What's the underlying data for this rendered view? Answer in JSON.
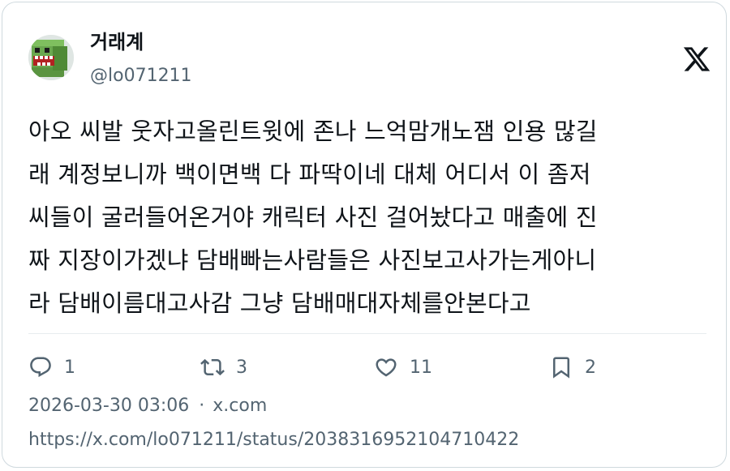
{
  "author": {
    "display_name": "거래계",
    "handle": "@lo071211",
    "avatar_icon": "green-block-creature-avatar"
  },
  "platform_icon": "x-logo-icon",
  "tweet": {
    "lines": [
      "아오 씨발 웃자고올린트윗에 존나 느억맘개노잼 인용 많길",
      "래 계정보니까 백이면백 다 파딱이네 대체 어디서 이 좀저",
      "씨들이 굴러들어온거야 캐릭터 사진 걸어놨다고 매출에 진",
      "짜 지장이가겠냐 담배빠는사람들은 사진보고사가는게아니",
      "라 담배이름대고사감 그냥 담배매대자체를안본다고"
    ]
  },
  "actions": {
    "reply": {
      "icon": "reply-icon",
      "count": "1"
    },
    "retweet": {
      "icon": "retweet-icon",
      "count": "3"
    },
    "like": {
      "icon": "heart-icon",
      "count": "11"
    },
    "bookmark": {
      "icon": "bookmark-icon",
      "count": "2"
    }
  },
  "meta": {
    "timestamp": "2026-03-30 03:06",
    "separator": "·",
    "source": "x.com",
    "url": "https://x.com/lo071211/status/2038316952104710422"
  },
  "colors": {
    "text": "#0f1419",
    "secondary": "#536471",
    "border": "#cfd9de"
  }
}
